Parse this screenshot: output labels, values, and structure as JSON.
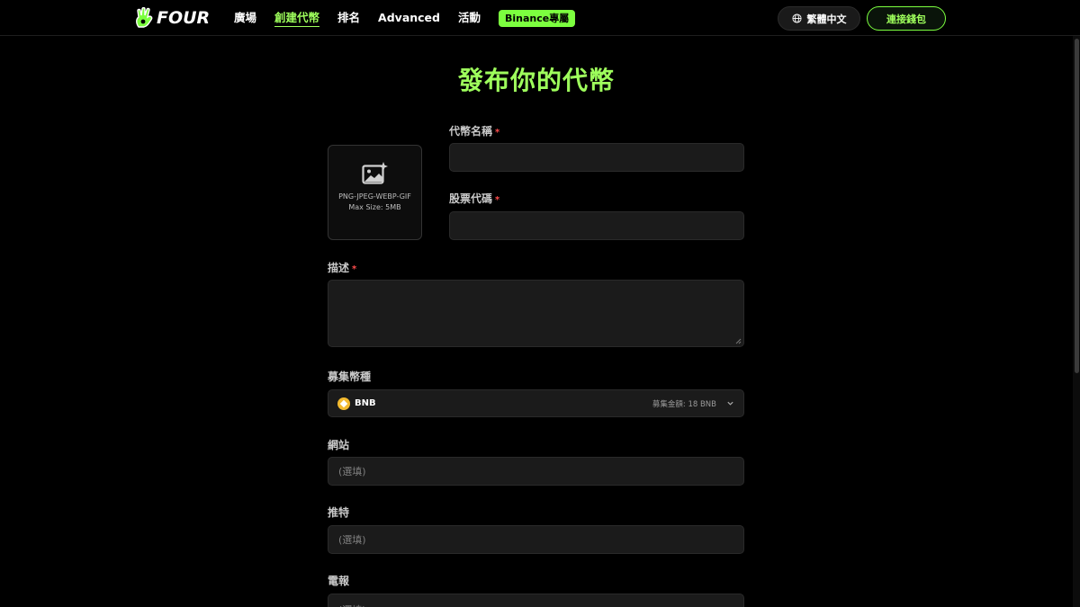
{
  "header": {
    "logo_text": "FOUR",
    "nav": [
      {
        "label": "廣場",
        "active": false
      },
      {
        "label": "創建代幣",
        "active": true
      },
      {
        "label": "排名",
        "active": false
      },
      {
        "label": "Advanced",
        "active": false
      },
      {
        "label": "活動",
        "active": false
      }
    ],
    "binance_badge": "Binance專屬",
    "language": "繁體中文",
    "connect_wallet": "連接錢包"
  },
  "page": {
    "title": "發布你的代幣"
  },
  "form": {
    "upload": {
      "formats": "PNG-JPEG-WEBP-GIF",
      "max_size": "Max Size: 5MB"
    },
    "token_name": {
      "label": "代幣名稱",
      "required_mark": "*",
      "value": ""
    },
    "ticker": {
      "label": "股票代碼",
      "required_mark": "*",
      "value": ""
    },
    "description": {
      "label": "描述",
      "required_mark": "*",
      "value": ""
    },
    "raise_currency": {
      "label": "募集幣種",
      "selected": "BNB",
      "meta": "募集金額: 18 BNB"
    },
    "website": {
      "label": "網站",
      "placeholder": "(選填)"
    },
    "twitter": {
      "label": "推特",
      "placeholder": "(選填)"
    },
    "telegram": {
      "label": "電報",
      "placeholder": "(選填)"
    }
  },
  "colors": {
    "accent": "#9eff5c",
    "badge": "#7cff3f",
    "background": "#000000",
    "input_bg": "#1b1b1b",
    "required": "#ff4d4d",
    "bnb": "#f3ba2f"
  }
}
